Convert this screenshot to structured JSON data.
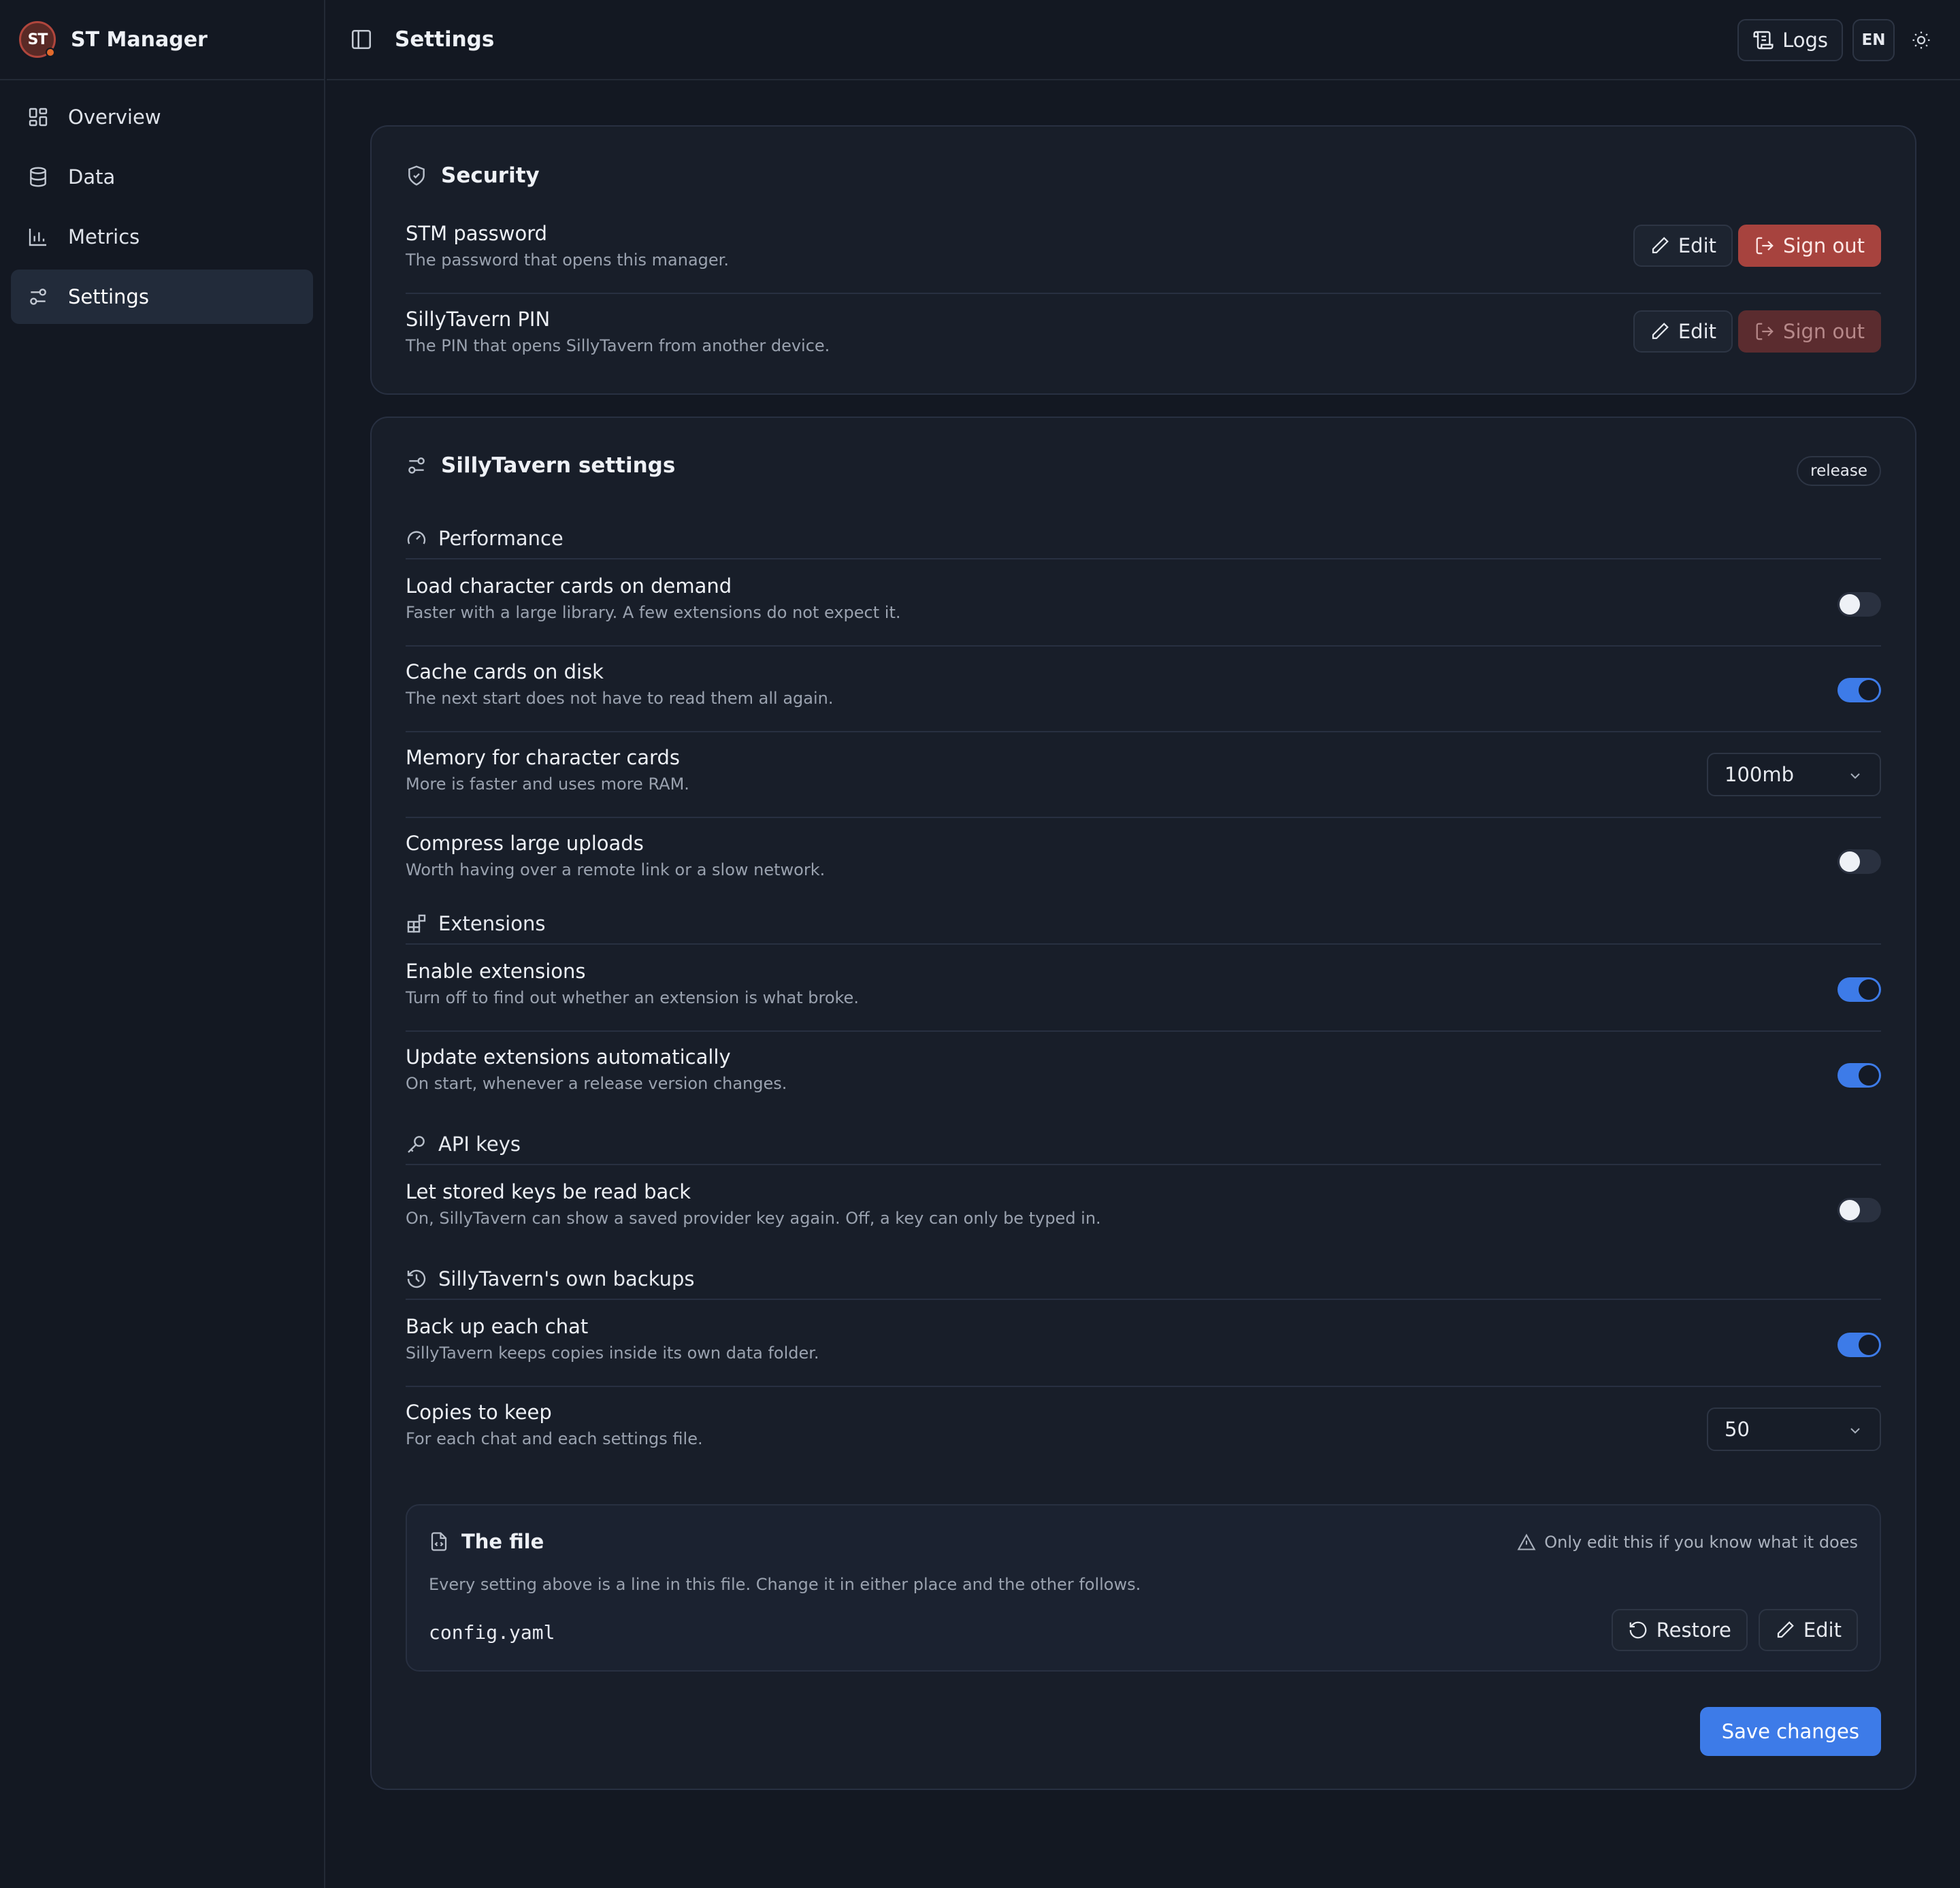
{
  "brand": {
    "logo_text": "ST",
    "name": "ST Manager"
  },
  "nav": [
    {
      "label": "Overview",
      "icon": "grid-icon"
    },
    {
      "label": "Data",
      "icon": "database-icon"
    },
    {
      "label": "Metrics",
      "icon": "bar-chart-icon"
    },
    {
      "label": "Settings",
      "icon": "sliders-icon",
      "active": true
    }
  ],
  "topbar": {
    "title": "Settings",
    "logs_label": "Logs",
    "lang_label": "EN",
    "theme_icon": "sun-icon"
  },
  "security": {
    "title": "Security",
    "rows": [
      {
        "title": "STM password",
        "desc": "The password that opens this manager.",
        "edit": "Edit",
        "signout": "Sign out",
        "signout_enabled": true
      },
      {
        "title": "SillyTavern PIN",
        "desc": "The PIN that opens SillyTavern from another device.",
        "edit": "Edit",
        "signout": "Sign out",
        "signout_enabled": false
      }
    ]
  },
  "st_settings": {
    "title": "SillyTavern settings",
    "badge": "release",
    "groups": {
      "performance": {
        "title": "Performance",
        "rows": [
          {
            "title": "Load character cards on demand",
            "desc": "Faster with a large library. A few extensions do not expect it.",
            "type": "toggle",
            "on": false
          },
          {
            "title": "Cache cards on disk",
            "desc": "The next start does not have to read them all again.",
            "type": "toggle",
            "on": true
          },
          {
            "title": "Memory for character cards",
            "desc": "More is faster and uses more RAM.",
            "type": "select",
            "value": "100mb"
          },
          {
            "title": "Compress large uploads",
            "desc": "Worth having over a remote link or a slow network.",
            "type": "toggle",
            "on": false
          }
        ]
      },
      "extensions": {
        "title": "Extensions",
        "rows": [
          {
            "title": "Enable extensions",
            "desc": "Turn off to find out whether an extension is what broke.",
            "type": "toggle",
            "on": true
          },
          {
            "title": "Update extensions automatically",
            "desc": "On start, whenever a release version changes.",
            "type": "toggle",
            "on": true
          }
        ]
      },
      "api_keys": {
        "title": "API keys",
        "rows": [
          {
            "title": "Let stored keys be read back",
            "desc": "On, SillyTavern can show a saved provider key again. Off, a key can only be typed in.",
            "type": "toggle",
            "on": false
          }
        ]
      },
      "backups": {
        "title": "SillyTavern's own backups",
        "rows": [
          {
            "title": "Back up each chat",
            "desc": "SillyTavern keeps copies inside its own data folder.",
            "type": "toggle",
            "on": true
          },
          {
            "title": "Copies to keep",
            "desc": "For each chat and each settings file.",
            "type": "select",
            "value": "50"
          }
        ]
      }
    },
    "file": {
      "title": "The file",
      "warning": "Only edit this if you know what it does",
      "desc": "Every setting above is a line in this file. Change it in either place and the other follows.",
      "name": "config.yaml",
      "restore": "Restore",
      "edit": "Edit"
    },
    "save_label": "Save changes"
  },
  "colors": {
    "accent": "#3d7be8",
    "danger": "#a7433e",
    "background": "#131822",
    "card": "#181e29"
  }
}
